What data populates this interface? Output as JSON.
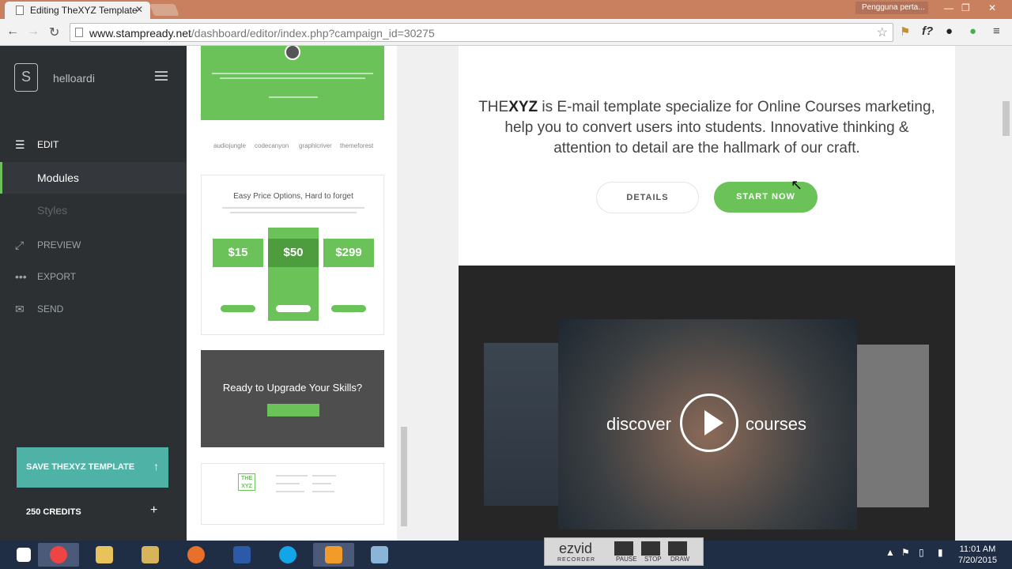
{
  "browser": {
    "tab_title": "Editing TheXYZ Template",
    "tab_close": "✕",
    "user_badge": "Pengguna perta...",
    "url_host": "www.stampready.net",
    "url_path": "/dashboard/editor/index.php?campaign_id=30275",
    "ext_font_label": "f?"
  },
  "sidebar": {
    "logo_letter": "S",
    "username": "helloardi",
    "nav": {
      "edit": "EDIT",
      "modules": "Modules",
      "styles": "Styles",
      "preview": "PREVIEW",
      "export": "EXPORT",
      "send": "SEND"
    },
    "save_button": "SAVE THEXYZ TEMPLATE",
    "credits": "250 CREDITS",
    "credits_plus": "+"
  },
  "modules_panel": {
    "logos": [
      "audiojungle",
      "codecanyon",
      "graphicriver",
      "themeforest"
    ],
    "pricing": {
      "title": "Easy Price Options, Hard to forget",
      "prices": [
        "$15",
        "$50",
        "$299"
      ]
    },
    "cta_title": "Ready to Upgrade Your Skills?",
    "footer_logo": "THE XYZ"
  },
  "editor": {
    "brand_light": "THE",
    "brand_bold": "XYZ",
    "description": " is E-mail template specialize for Online Courses marketing, help you to convert users into students. Innovative thinking & attention to detail are the hallmark of our craft.",
    "details_button": "DETAILS",
    "start_button": "START NOW",
    "video_left": "discover",
    "video_right": "courses"
  },
  "recorder": {
    "logo": "ezvid",
    "label": "RECORDER",
    "pause": "PAUSE",
    "stop": "STOP",
    "draw": "DRAW"
  },
  "system_tray": {
    "time": "11:01 AM",
    "date": "7/20/2015"
  },
  "colors": {
    "accent_green": "#6ac259",
    "sidebar_bg": "#2c3033",
    "save_teal": "#4fb2a6",
    "taskbar": "#1f2d45"
  }
}
